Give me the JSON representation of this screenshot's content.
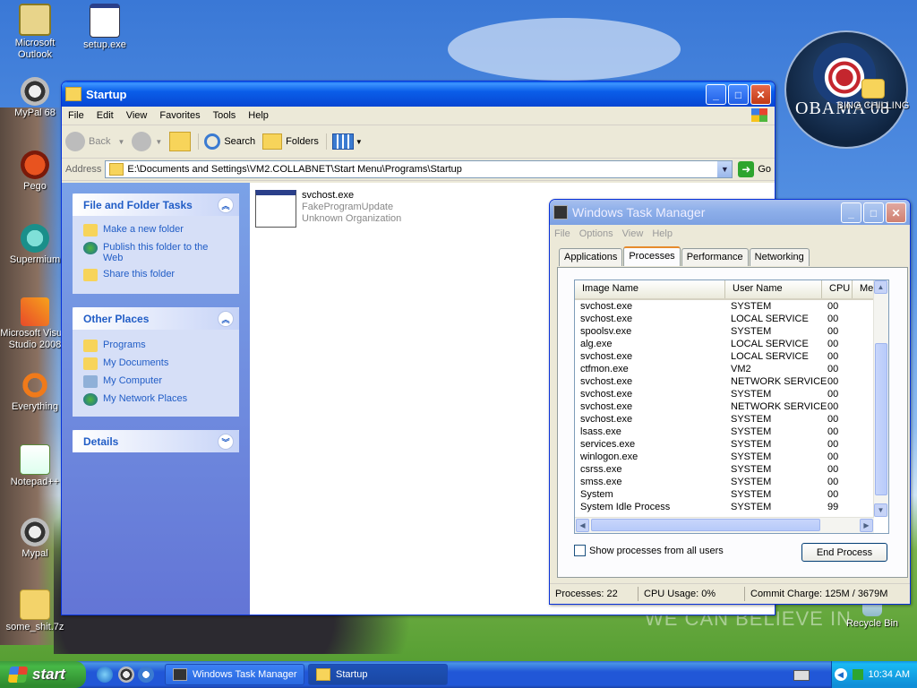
{
  "desktop": {
    "icons": [
      {
        "label": "Microsoft Outlook"
      },
      {
        "label": "setup.exe"
      },
      {
        "label": "MyPal 68"
      },
      {
        "label": "Pego"
      },
      {
        "label": "Supermium"
      },
      {
        "label": "Microsoft Visual Studio 2008"
      },
      {
        "label": "Everything"
      },
      {
        "label": "Notepad++"
      },
      {
        "label": "Mypal"
      },
      {
        "label": "some_shit.7z"
      },
      {
        "label": "BING CHILLING"
      },
      {
        "label": "Recycle Bin"
      }
    ],
    "badge_text": "OBAMA'08",
    "slogan": "WE CAN BELIEVE IN"
  },
  "explorer": {
    "title": "Startup",
    "menu": [
      "File",
      "Edit",
      "View",
      "Favorites",
      "Tools",
      "Help"
    ],
    "toolbar": {
      "back": "Back",
      "search": "Search",
      "folders": "Folders"
    },
    "address_label": "Address",
    "address_value": "E:\\Documents and Settings\\VM2.COLLABNET\\Start Menu\\Programs\\Startup",
    "go_label": "Go",
    "tasks": {
      "title": "File and Folder Tasks",
      "items": [
        "Make a new folder",
        "Publish this folder to the Web",
        "Share this folder"
      ]
    },
    "other_places": {
      "title": "Other Places",
      "items": [
        "Programs",
        "My Documents",
        "My Computer",
        "My Network Places"
      ]
    },
    "details_title": "Details",
    "file": {
      "name": "svchost.exe",
      "description": "FakeProgramUpdate",
      "company": "Unknown Organization"
    }
  },
  "taskmgr": {
    "title": "Windows Task Manager",
    "menu": [
      "File",
      "Options",
      "View",
      "Help"
    ],
    "tabs": [
      "Applications",
      "Processes",
      "Performance",
      "Networking"
    ],
    "columns": [
      "Image Name",
      "User Name",
      "CPU",
      "Me"
    ],
    "processes": [
      {
        "name": "svchost.exe",
        "user": "SYSTEM",
        "cpu": "00"
      },
      {
        "name": "svchost.exe",
        "user": "LOCAL SERVICE",
        "cpu": "00"
      },
      {
        "name": "spoolsv.exe",
        "user": "SYSTEM",
        "cpu": "00"
      },
      {
        "name": "alg.exe",
        "user": "LOCAL SERVICE",
        "cpu": "00"
      },
      {
        "name": "svchost.exe",
        "user": "LOCAL SERVICE",
        "cpu": "00"
      },
      {
        "name": "ctfmon.exe",
        "user": "VM2",
        "cpu": "00"
      },
      {
        "name": "svchost.exe",
        "user": "NETWORK SERVICE",
        "cpu": "00"
      },
      {
        "name": "svchost.exe",
        "user": "SYSTEM",
        "cpu": "00"
      },
      {
        "name": "svchost.exe",
        "user": "NETWORK SERVICE",
        "cpu": "00"
      },
      {
        "name": "svchost.exe",
        "user": "SYSTEM",
        "cpu": "00"
      },
      {
        "name": "lsass.exe",
        "user": "SYSTEM",
        "cpu": "00"
      },
      {
        "name": "services.exe",
        "user": "SYSTEM",
        "cpu": "00"
      },
      {
        "name": "winlogon.exe",
        "user": "SYSTEM",
        "cpu": "00"
      },
      {
        "name": "csrss.exe",
        "user": "SYSTEM",
        "cpu": "00"
      },
      {
        "name": "smss.exe",
        "user": "SYSTEM",
        "cpu": "00"
      },
      {
        "name": "System",
        "user": "SYSTEM",
        "cpu": "00"
      },
      {
        "name": "System Idle Process",
        "user": "SYSTEM",
        "cpu": "99"
      }
    ],
    "show_all_label": "Show processes from all users",
    "end_process_label": "End Process",
    "status": {
      "processes": "Processes: 22",
      "cpu": "CPU Usage: 0%",
      "commit": "Commit Charge: 125M / 3679M"
    }
  },
  "taskbar": {
    "start_label": "start",
    "tasks": [
      "Windows Task Manager",
      "Startup"
    ],
    "clock": "10:34 AM"
  },
  "colors": {
    "xp_blue": "#0a5ee9",
    "link_blue": "#215dc6",
    "start_green": "#3c9a3c"
  }
}
